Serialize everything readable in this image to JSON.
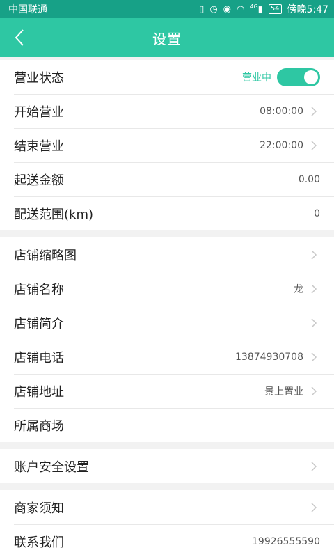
{
  "status_bar": {
    "carrier": "中国联通",
    "icons": [
      "vibrate-icon",
      "alarm-icon",
      "eye-icon",
      "wifi-icon",
      "signal-icon"
    ],
    "signal_label": "4G",
    "battery": "54",
    "time": "傍晚5:47"
  },
  "header": {
    "title": "设置"
  },
  "groups": [
    {
      "rows": [
        {
          "label": "营业状态",
          "value": "营业中",
          "toggle": true
        },
        {
          "label": "开始营业",
          "value": "08:00:00",
          "chevron": true
        },
        {
          "label": "结束营业",
          "value": "22:00:00",
          "chevron": true
        },
        {
          "label": "起送金额",
          "value": "0.00",
          "chevron": false
        },
        {
          "label": "配送范围(km)",
          "value": "0",
          "chevron": false
        }
      ]
    },
    {
      "rows": [
        {
          "label": "店铺缩略图",
          "value": "",
          "chevron": true
        },
        {
          "label": "店铺名称",
          "value": "龙",
          "chevron": true
        },
        {
          "label": "店铺简介",
          "value": "",
          "chevron": true
        },
        {
          "label": "店铺电话",
          "value": "13874930708",
          "chevron": true
        },
        {
          "label": "店铺地址",
          "value": "景上置业",
          "chevron": true
        },
        {
          "label": "所属商场",
          "value": "",
          "chevron": false
        }
      ]
    },
    {
      "rows": [
        {
          "label": "账户安全设置",
          "value": "",
          "chevron": true
        }
      ]
    },
    {
      "rows": [
        {
          "label": "商家须知",
          "value": "",
          "chevron": true
        },
        {
          "label": "联系我们",
          "value": "19926555590",
          "chevron": false
        }
      ]
    }
  ],
  "colors": {
    "status_bar": "#17a187",
    "header": "#2ec7a3",
    "accent": "#2ec7a3"
  }
}
